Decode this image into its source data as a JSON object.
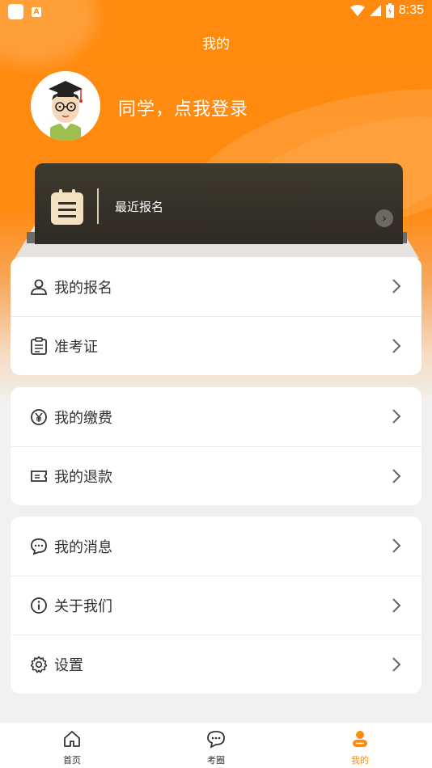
{
  "status_bar": {
    "time": "8:35",
    "notification_badge": "A"
  },
  "header": {
    "title": "我的"
  },
  "profile": {
    "login_prompt": "同学，点我登录"
  },
  "recent_card": {
    "label": "最近报名"
  },
  "menu_groups": [
    {
      "items": [
        {
          "label": "我的报名",
          "icon": "user-icon"
        },
        {
          "label": "准考证",
          "icon": "clipboard-icon"
        }
      ]
    },
    {
      "items": [
        {
          "label": "我的缴费",
          "icon": "yen-icon"
        },
        {
          "label": "我的退款",
          "icon": "ticket-icon"
        }
      ]
    },
    {
      "items": [
        {
          "label": "我的消息",
          "icon": "chat-icon"
        },
        {
          "label": "关于我们",
          "icon": "info-icon"
        },
        {
          "label": "设置",
          "icon": "gear-icon"
        }
      ]
    }
  ],
  "tabbar": {
    "tabs": [
      {
        "label": "首页",
        "icon": "home-icon",
        "active": false
      },
      {
        "label": "考圈",
        "icon": "chat-bubble-icon",
        "active": false
      },
      {
        "label": "我的",
        "icon": "profile-icon",
        "active": true
      }
    ]
  },
  "colors": {
    "accent": "#ff8a0d",
    "card_dark": "#342f27",
    "text": "#333333"
  }
}
